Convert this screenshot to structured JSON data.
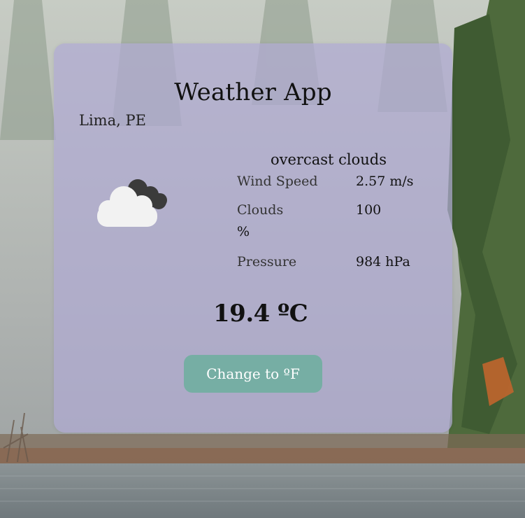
{
  "app": {
    "title": "Weather App",
    "location": "Lima, PE",
    "description": "overcast clouds",
    "icon": "overcast-clouds-icon",
    "stats": [
      {
        "label": "Wind Speed",
        "value": "2.57 m/s"
      },
      {
        "label": "Clouds",
        "value": "100",
        "unit_line": "%"
      },
      {
        "label": "Pressure",
        "value": "984 hPa"
      }
    ],
    "temperature": "19.4 ºC",
    "toggle_button": "Change to ºF"
  },
  "colors": {
    "card": "#b0aad2",
    "button": "#76aea4",
    "button_text": "#ffffff"
  }
}
